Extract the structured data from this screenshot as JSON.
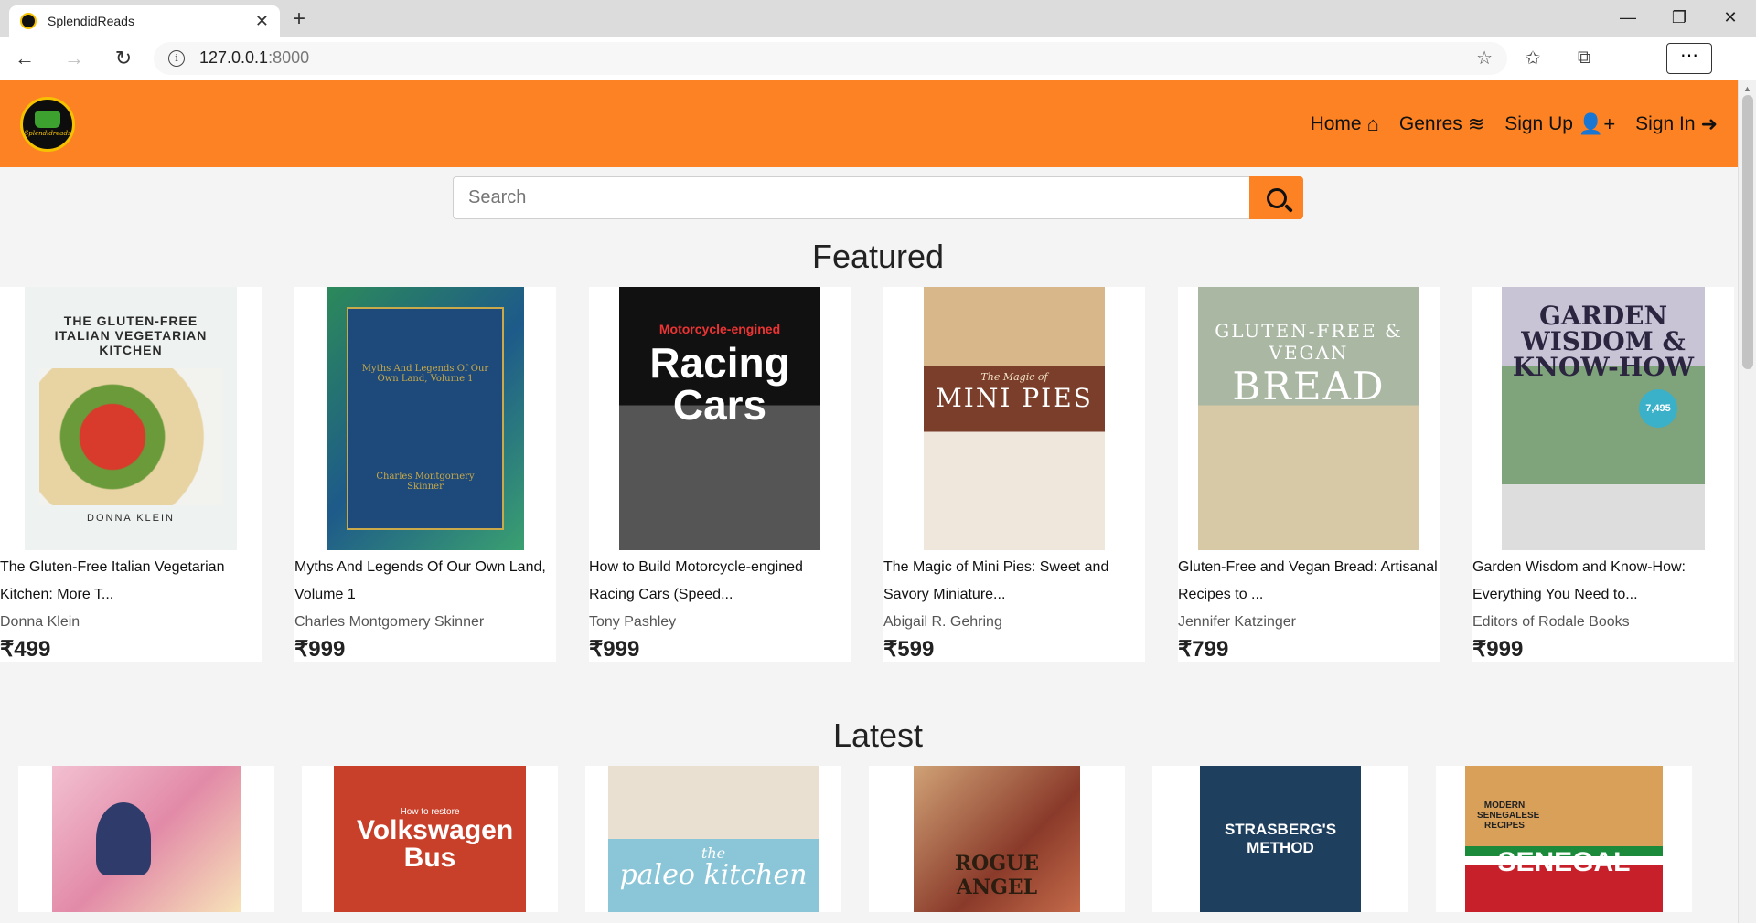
{
  "browser": {
    "tab_title": "SplendidReads",
    "new_tab": "+",
    "url_host": "127.0.0.1",
    "url_port": ":8000",
    "window_controls": [
      "—",
      "❐",
      "✕"
    ]
  },
  "site": {
    "logo_text": "Splendidreads",
    "nav": [
      {
        "label": "Home",
        "icon": "home-icon"
      },
      {
        "label": "Genres",
        "icon": "layers-icon"
      },
      {
        "label": "Sign Up",
        "icon": "user-plus-icon"
      },
      {
        "label": "Sign In",
        "icon": "sign-in-icon"
      }
    ],
    "search": {
      "placeholder": "Search"
    },
    "accent_color": "#fc8223"
  },
  "featured": {
    "heading": "Featured",
    "books": [
      {
        "title": "The Gluten-Free Italian Vegetarian Kitchen: More T...",
        "author": "Donna Klein",
        "price": "₹499",
        "cover_text": "THE GLUTEN-FREE ITALIAN VEGETARIAN KITCHEN",
        "cover_sub": "DONNA KLEIN"
      },
      {
        "title": "Myths And Legends Of Our Own Land, Volume 1",
        "author": "Charles Montgomery Skinner",
        "price": "₹999",
        "cover_text": "Myths And Legends Of Our Own Land, Volume 1",
        "cover_sub": "Charles Montgomery Skinner"
      },
      {
        "title": "How to Build Motorcycle-engined Racing Cars (Speed...",
        "author": "Tony Pashley",
        "price": "₹999",
        "cover_text": "Racing Cars",
        "cover_sub": "Motorcycle-engined"
      },
      {
        "title": "The Magic of Mini Pies: Sweet and Savory Miniature...",
        "author": "Abigail R. Gehring",
        "price": "₹599",
        "cover_text": "MINI PIES",
        "cover_sub": "The Magic of"
      },
      {
        "title": "Gluten-Free and Vegan Bread: Artisanal Recipes to ...",
        "author": "Jennifer Katzinger",
        "price": "₹799",
        "cover_text": "BREAD",
        "cover_sub": "GLUTEN-FREE & VEGAN"
      },
      {
        "title": "Garden Wisdom and Know-How: Everything You Need to...",
        "author": "Editors of Rodale Books",
        "price": "₹999",
        "cover_text": "GARDEN WISDOM & KNOW-HOW",
        "cover_sub": "7,495"
      }
    ]
  },
  "latest": {
    "heading": "Latest",
    "covers": [
      {
        "text": ""
      },
      {
        "text": "Volkswagen Bus",
        "sub": "How to restore"
      },
      {
        "text": "paleo kitchen",
        "sub": "the"
      },
      {
        "text": "ROGUE ANGEL",
        "sub": ""
      },
      {
        "text": "STRASBERG'S METHOD",
        "sub": ""
      },
      {
        "text": "SENEGAL",
        "sub": "MODERN SENEGALESE RECIPES"
      }
    ]
  }
}
